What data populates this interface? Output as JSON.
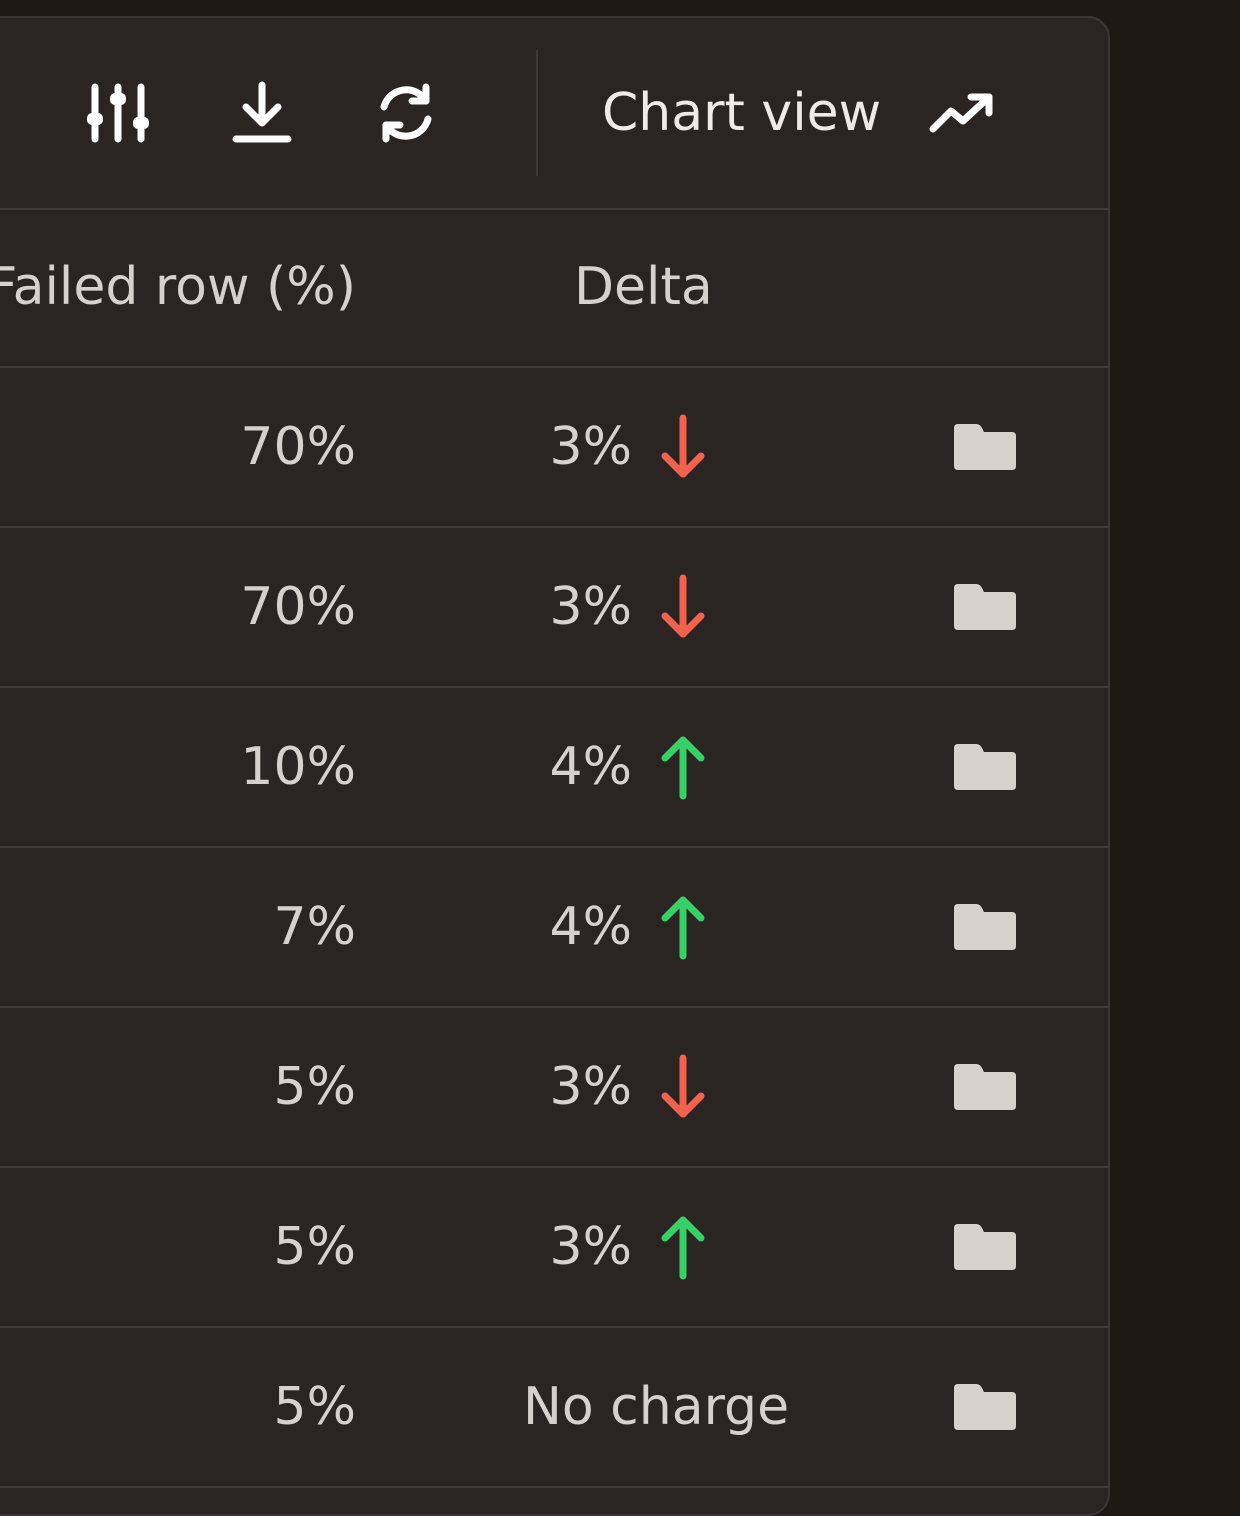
{
  "toolbar": {
    "icons": [
      "sliders-icon",
      "download-icon",
      "refresh-icon"
    ],
    "chart_view_label": "Chart view",
    "chart_view_icon": "trending-up-icon"
  },
  "table": {
    "columns": [
      "Failed row (%)",
      "Delta"
    ],
    "rows": [
      {
        "failed": "70%",
        "delta": "3%",
        "direction": "down"
      },
      {
        "failed": "70%",
        "delta": "3%",
        "direction": "down"
      },
      {
        "failed": "10%",
        "delta": "4%",
        "direction": "up"
      },
      {
        "failed": "7%",
        "delta": "4%",
        "direction": "up"
      },
      {
        "failed": "5%",
        "delta": "3%",
        "direction": "down"
      },
      {
        "failed": "5%",
        "delta": "3%",
        "direction": "up"
      },
      {
        "failed": "5%",
        "delta": "No charge",
        "direction": "none"
      }
    ]
  },
  "colors": {
    "down": "#f2634f",
    "up": "#37d067",
    "folder": "#d6d1cc"
  }
}
